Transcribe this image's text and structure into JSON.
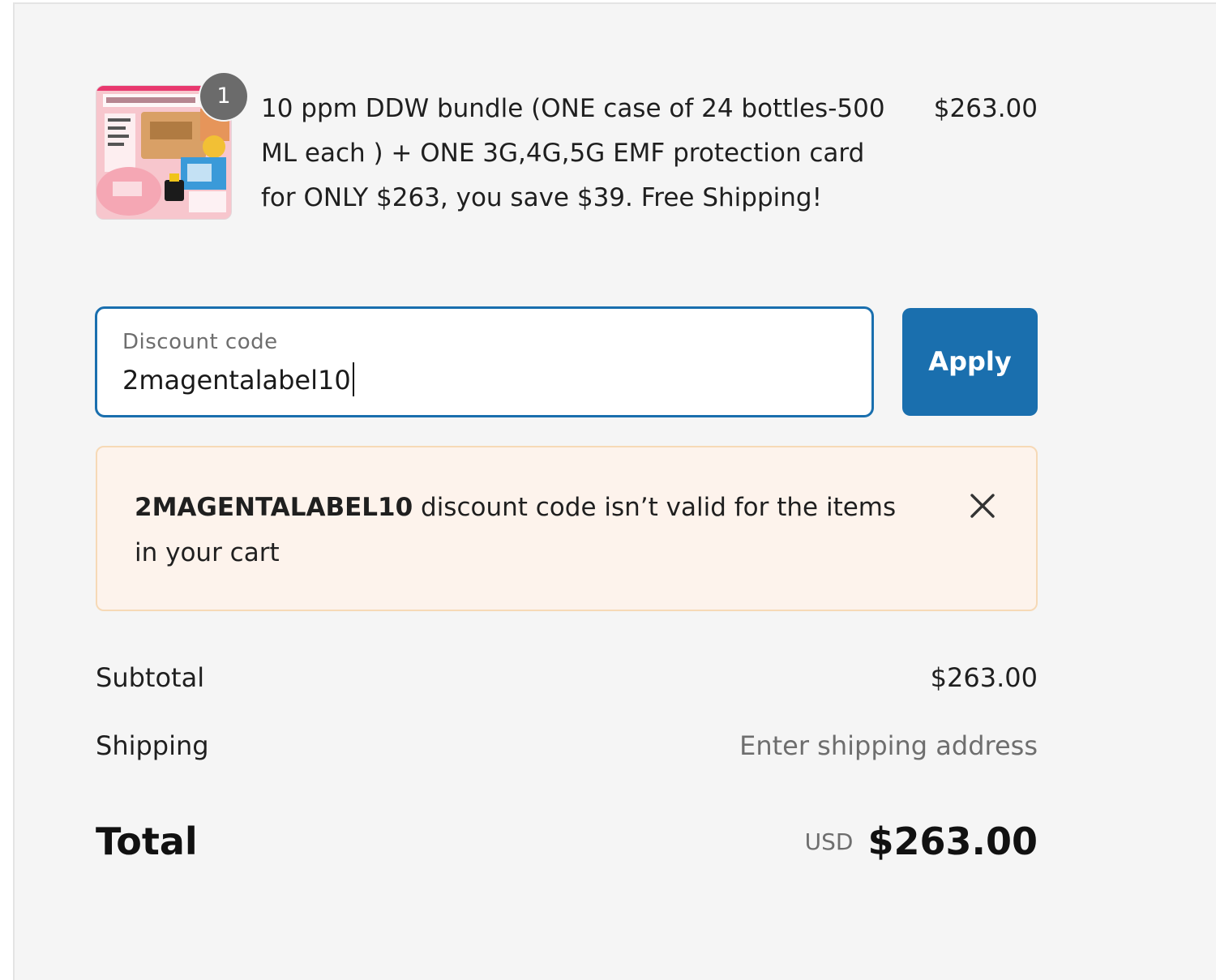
{
  "product": {
    "quantity": "1",
    "title": "10 ppm DDW bundle (ONE case of 24 bottles-500 ML each ) + ONE 3G,4G,5G EMF protection card for ONLY $263, you save $39. Free Shipping!",
    "price": "$263.00"
  },
  "discount": {
    "label": "Discount code",
    "value": "2magentalabel10",
    "apply_label": "Apply"
  },
  "notice": {
    "code": "2MAGENTALABEL10",
    "message": " discount code isn’t valid for the items in your cart"
  },
  "summary": {
    "subtotal_label": "Subtotal",
    "subtotal_value": "$263.00",
    "shipping_label": "Shipping",
    "shipping_value": "Enter shipping address",
    "total_label": "Total",
    "currency": "USD",
    "total_value": "$263.00"
  },
  "colors": {
    "accent": "#1a6fae",
    "notice_bg": "#fdf3ec",
    "notice_border": "#f6d9b6",
    "panel_bg": "#f5f5f5"
  }
}
